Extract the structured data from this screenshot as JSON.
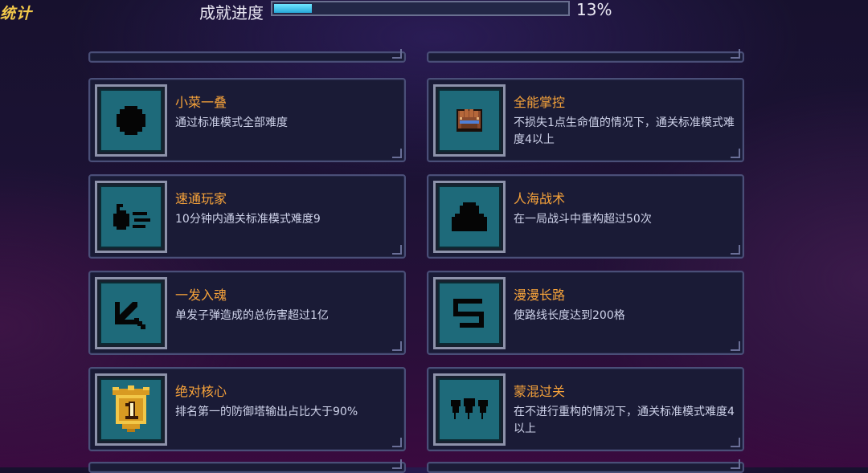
{
  "header": {
    "stats_tab": "统计",
    "progress_label": "成就进度",
    "progress_percent_text": "13%",
    "progress_value": 0.13
  },
  "achievements": [
    {
      "title": "小菜一叠",
      "desc": "通过标准模式全部难度",
      "icon": "locked-blob-icon",
      "unlocked": false
    },
    {
      "title": "全能掌控",
      "desc": "不损失1点生命值的情况下，通关标准模式难度4以上",
      "icon": "gauntlet-fist-icon",
      "unlocked": true
    },
    {
      "title": "速通玩家",
      "desc": "10分钟内通关标准模式难度9",
      "icon": "locked-speed-bomb-icon",
      "unlocked": false
    },
    {
      "title": "人海战术",
      "desc": "在一局战斗中重构超过50次",
      "icon": "locked-crowd-icon",
      "unlocked": false
    },
    {
      "title": "一发入魂",
      "desc": "单发子弹造成的总伤害超过1亿",
      "icon": "locked-arrow-icon",
      "unlocked": false
    },
    {
      "title": "漫漫长路",
      "desc": "使路线长度达到200格",
      "icon": "locked-path-icon",
      "unlocked": false
    },
    {
      "title": "绝对核心",
      "desc": "排名第一的防御塔输出占比大于90%",
      "icon": "gold-rank-one-badge-icon",
      "unlocked": true
    },
    {
      "title": "蒙混过关",
      "desc": "在不进行重构的情况下，通关标准模式难度4以上",
      "icon": "locked-trees-icon",
      "unlocked": false
    }
  ],
  "colors": {
    "title": "#f7a33a",
    "desc": "#cfd3ea",
    "card_bg": "#1a1b36",
    "card_border": "#4a4f78",
    "icon_bg": "#1e6a7a",
    "progress_fill": "#3fc4ee"
  }
}
